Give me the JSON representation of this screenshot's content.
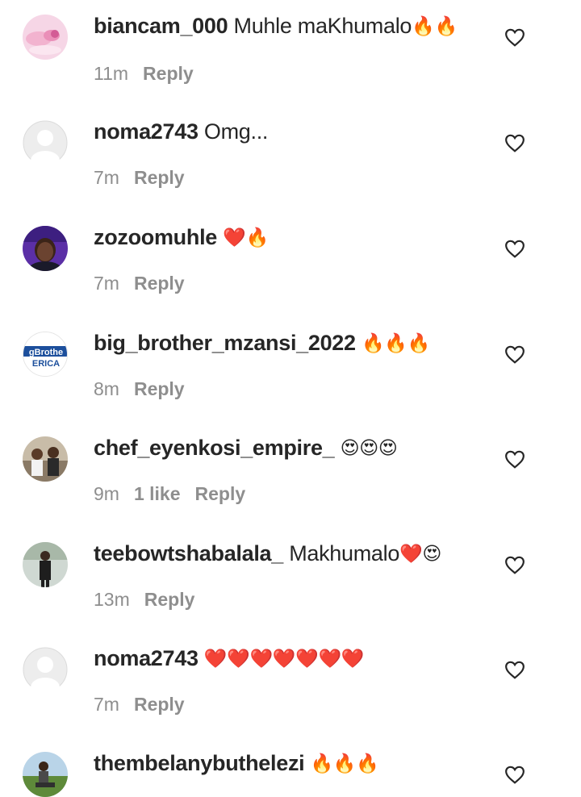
{
  "comments": [
    {
      "username": "biancam_000",
      "text": "Muhle maKhumalo",
      "emojis": "🔥🔥",
      "time": "11m",
      "likes": "",
      "reply": "Reply",
      "avatar": "pink-nails-photo"
    },
    {
      "username": "noma2743",
      "text": "Omg...",
      "emojis": "",
      "time": "7m",
      "likes": "",
      "reply": "Reply",
      "avatar": "default-avatar"
    },
    {
      "username": "zozoomuhle",
      "text": "",
      "emojis": "❤️🔥",
      "time": "7m",
      "likes": "",
      "reply": "Reply",
      "avatar": "woman-photo"
    },
    {
      "username": "big_brother_mzansi_2022",
      "text": "",
      "emojis": "🔥🔥🔥",
      "time": "8m",
      "likes": "",
      "reply": "Reply",
      "avatar": "big-brother-logo",
      "avatar_text_1": "gBrothe",
      "avatar_text_2": "ERICA"
    },
    {
      "username": "chef_eyenkosi_empire_",
      "text": "",
      "emojis": "😍😍😍",
      "time": "9m",
      "likes": "1 like",
      "reply": "Reply",
      "avatar": "people-photo"
    },
    {
      "username": "teebowtshabalala_",
      "text": "Makhumalo",
      "emojis": "❤️😍",
      "time": "13m",
      "likes": "",
      "reply": "Reply",
      "avatar": "man-outdoor-photo"
    },
    {
      "username": "noma2743",
      "text": "",
      "emojis": "❤️❤️❤️❤️❤️❤️❤️",
      "time": "7m",
      "likes": "",
      "reply": "Reply",
      "avatar": "default-avatar"
    },
    {
      "username": "thembelanybuthelezi",
      "text": "",
      "emojis": "🔥🔥🔥",
      "time": "",
      "likes": "",
      "reply": "",
      "avatar": "man-grass-photo"
    }
  ],
  "icons": {
    "like": "heart-outline-icon"
  },
  "colors": {
    "username": "#262626",
    "meta": "#8e8e8e",
    "background": "#ffffff"
  }
}
